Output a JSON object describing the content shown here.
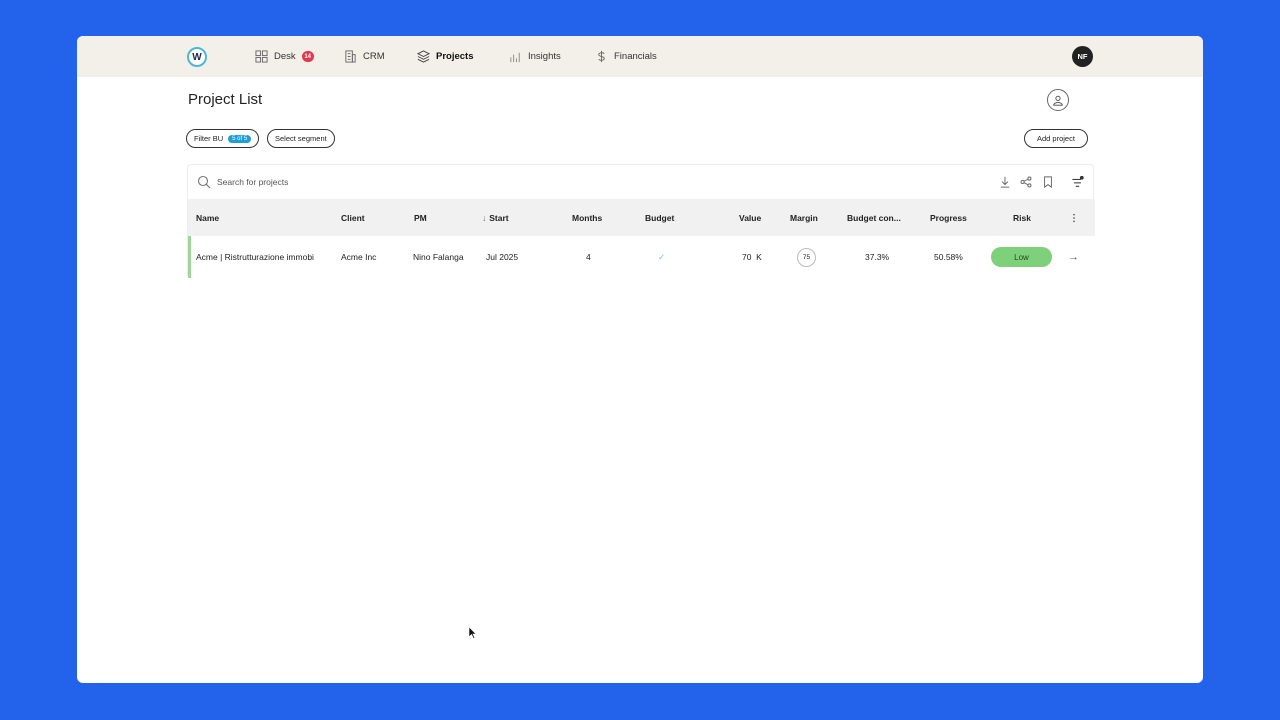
{
  "nav": {
    "logo_letter": "W",
    "items": [
      {
        "label": "Desk",
        "badge": "14"
      },
      {
        "label": "CRM"
      },
      {
        "label": "Projects"
      },
      {
        "label": "Insights"
      },
      {
        "label": "Financials"
      }
    ],
    "avatar_initials": "NF"
  },
  "page": {
    "title": "Project List",
    "filter_bu_label": "Filter BU",
    "filter_bu_count": "5 of 5",
    "segment_label": "Select segment",
    "add_project_label": "Add project"
  },
  "search": {
    "placeholder": "Search for projects"
  },
  "table": {
    "columns": [
      "Name",
      "Client",
      "PM",
      "Start",
      "Months",
      "Budget",
      "Value",
      "Margin",
      "Budget con...",
      "Progress",
      "Risk"
    ],
    "sort_indicator": "↓",
    "rows": [
      {
        "name": "Acme | Ristrutturazione immobi",
        "client": "Acme Inc",
        "pm": "Nino Falanga",
        "start": "Jul 2025",
        "months": "4",
        "budget": "✓",
        "value": "70  K",
        "margin": "75",
        "budget_consumed": "37.3%",
        "progress": "50.58%",
        "risk": "Low",
        "arrow": "→"
      }
    ]
  },
  "colors": {
    "background": "#2363ec",
    "accent": "#1e9fd6",
    "risk_low": "#7ed07a",
    "badge": "#e03a4e"
  }
}
